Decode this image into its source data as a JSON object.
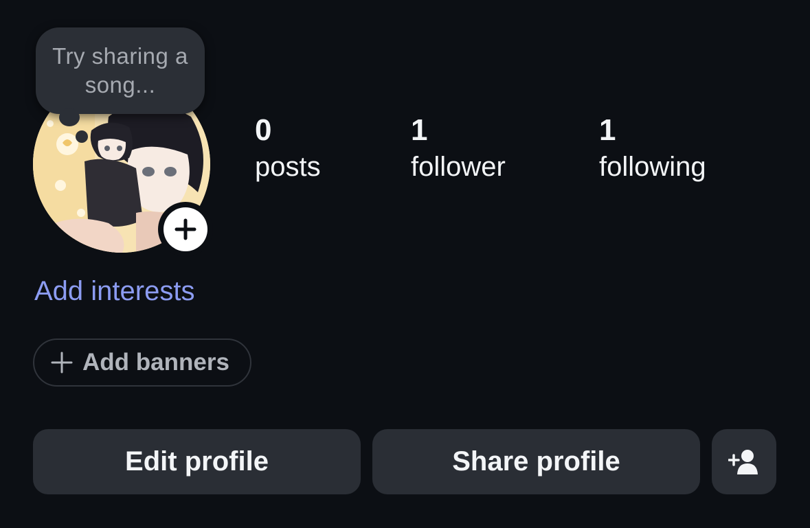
{
  "note": {
    "text": "Try sharing a song..."
  },
  "avatar": {
    "add_icon": "plus-icon"
  },
  "stats": {
    "posts": {
      "count": "0",
      "label": "posts"
    },
    "followers": {
      "count": "1",
      "label": "follower"
    },
    "following": {
      "count": "1",
      "label": "following"
    }
  },
  "add_interests_label": "Add interests",
  "banners": {
    "icon": "plus-icon",
    "label": "Add banners"
  },
  "actions": {
    "edit_label": "Edit profile",
    "share_label": "Share profile",
    "add_person_icon": "add-person-icon"
  },
  "colors": {
    "background": "#0c0f14",
    "button": "#2a2e35",
    "link": "#8c9cf2",
    "note_bubble": "#2b2f36"
  }
}
